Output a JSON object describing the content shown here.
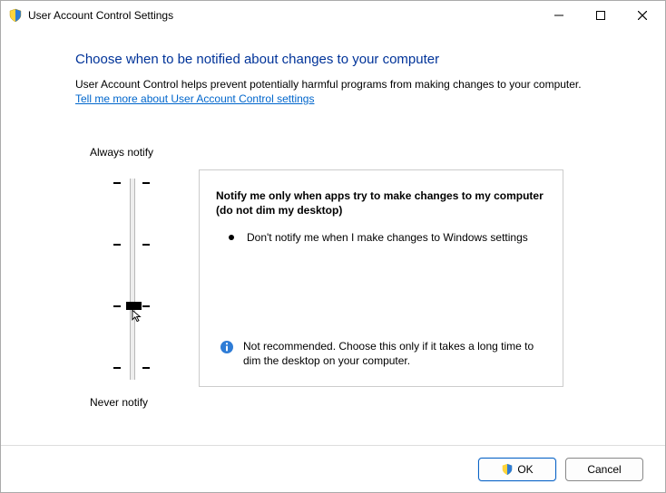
{
  "window": {
    "title": "User Account Control Settings"
  },
  "heading": "Choose when to be notified about changes to your computer",
  "description": "User Account Control helps prevent potentially harmful programs from making changes to your computer.",
  "link": "Tell me more about User Account Control settings",
  "slider": {
    "top_label": "Always notify",
    "bottom_label": "Never notify",
    "levels": 4,
    "current_level": 2
  },
  "panel": {
    "title": "Notify me only when apps try to make changes to my computer (do not dim my desktop)",
    "bullets": [
      "Don't notify me when I make changes to Windows settings"
    ],
    "warning": "Not recommended. Choose this only if it takes a long time to dim the desktop on your computer."
  },
  "buttons": {
    "ok": "OK",
    "cancel": "Cancel"
  }
}
